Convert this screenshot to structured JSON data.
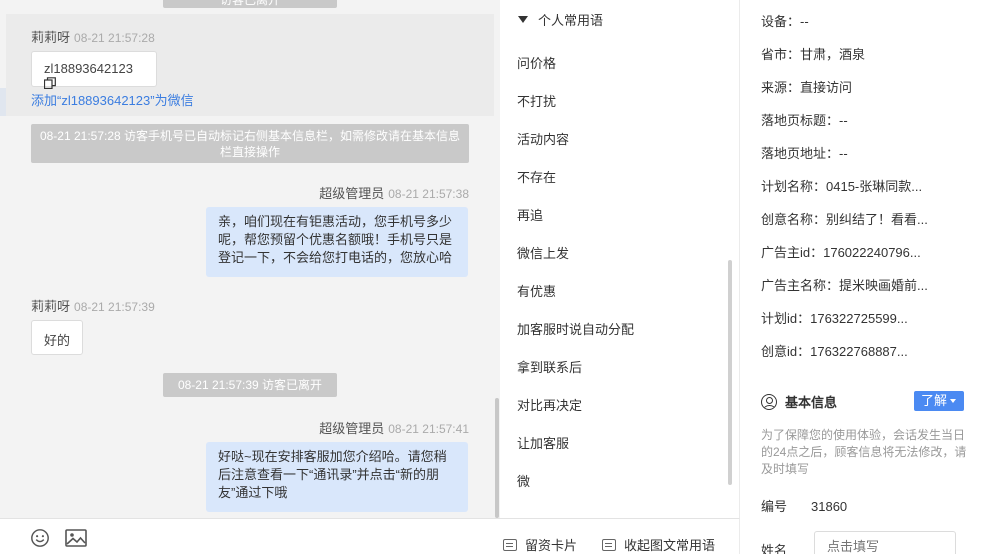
{
  "chat": {
    "system_top": "访客已离开",
    "messages": [
      {
        "sender": "莉莉呀",
        "time": "08-21 21:57:28",
        "text": "zl18893642123"
      },
      {
        "add_wechat": "添加“zl18893642123”为微信"
      },
      {
        "system": "08-21 21:57:28 访客手机号已自动标记右侧基本信息栏，如需修改请在基本信息栏直接操作"
      },
      {
        "sender": "超级管理员",
        "time": "08-21 21:57:38",
        "text": "亲，咱们现在有钜惠活动，您手机号多少呢，帮您预留个优惠名额哦！手机号只是登记一下，不会给您打电话的，您放心哈"
      },
      {
        "sender": "莉莉呀",
        "time": "08-21 21:57:39",
        "text": "好的"
      },
      {
        "system": "08-21 21:57:39 访客已离开"
      },
      {
        "sender": "超级管理员",
        "time": "08-21 21:57:41",
        "text": "好哒~现在安排客服加您介绍哈。请您稍后注意查看一下“通讯录”并点击“新的朋友”通过下哦"
      }
    ],
    "footer_icons": [
      "emoji-icon",
      "image-icon"
    ]
  },
  "phrases": {
    "header": "个人常用语",
    "items": [
      "问价格",
      "不打扰",
      "活动内容",
      "不存在",
      "再追",
      "微信上发",
      "有优惠",
      "加客服时说自动分配",
      "拿到联系后",
      "对比再决定",
      "让加客服",
      "微"
    ],
    "footer": {
      "card": "留资卡片",
      "collapse": "收起图文常用语"
    }
  },
  "info": {
    "rows": [
      "设备：--",
      "省市：甘肃，酒泉",
      "来源：直接访问",
      "落地页标题：--",
      "落地页地址：--",
      "计划名称：0415-张琳同款...",
      "创意名称：别纠结了！看看...",
      "广告主id：176022240796...",
      "广告主名称：提米映画婚前...",
      "计划id：176322725599...",
      "创意id：176322768887..."
    ],
    "section_title": "基本信息",
    "learn_button": "了解",
    "note": "为了保障您的使用体验，会话发生当日的24点之后，顾客信息将无法修改，请及时填写",
    "id_label": "编号",
    "id_value": "31860",
    "name_label": "姓名",
    "name_placeholder": "点击填写"
  }
}
